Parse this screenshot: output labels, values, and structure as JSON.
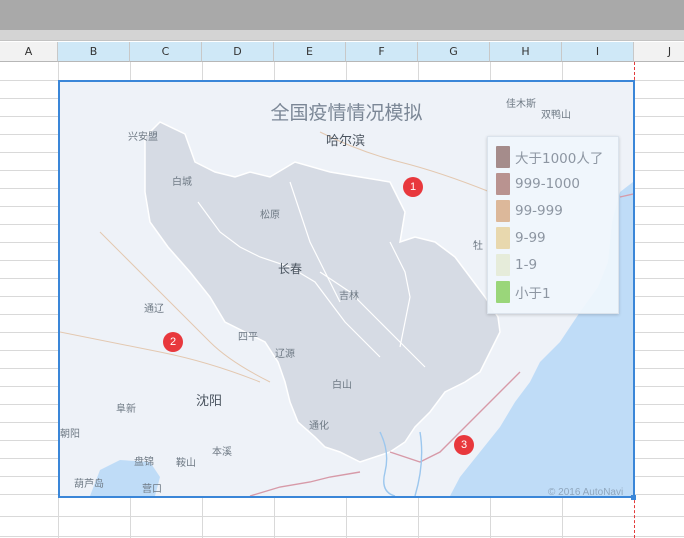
{
  "columns": [
    {
      "label": "A",
      "selected": false
    },
    {
      "label": "B",
      "selected": true
    },
    {
      "label": "C",
      "selected": true
    },
    {
      "label": "D",
      "selected": true
    },
    {
      "label": "E",
      "selected": true
    },
    {
      "label": "F",
      "selected": true
    },
    {
      "label": "G",
      "selected": true
    },
    {
      "label": "H",
      "selected": true
    },
    {
      "label": "I",
      "selected": true
    },
    {
      "label": "J",
      "selected": false
    }
  ],
  "chart": {
    "title": "全国疫情情况模拟",
    "copyright": "© 2016 AutoNavi",
    "legend": [
      {
        "label": "大于1000人了",
        "color": "#a58c8b"
      },
      {
        "label": "999-1000",
        "color": "#b99390"
      },
      {
        "label": "99-999",
        "color": "#dcb89a"
      },
      {
        "label": "9-99",
        "color": "#e8d8ae"
      },
      {
        "label": "1-9",
        "color": "#e6ecda"
      },
      {
        "label": "小于1",
        "color": "#9ad67a"
      }
    ],
    "markers": [
      "1",
      "2",
      "3"
    ],
    "places": {
      "harbin": "哈尔滨",
      "changchun": "长春",
      "shenyang": "沈阳",
      "xinganmeng": "兴安盟",
      "baicheng": "白城",
      "songyuan": "松原",
      "jilin": "吉林",
      "tonghua": "通化",
      "baishan": "白山",
      "siping": "四平",
      "liaoyuan": "辽源",
      "tongliao": "通辽",
      "fuxin": "阜新",
      "chaoyang": "朝阳",
      "huludao": "葫芦岛",
      "panjin": "盘锦",
      "anshan": "鞍山",
      "benxi": "本溪",
      "yingkou": "营口",
      "jiamusi": "佳木斯",
      "shuangyashan": "双鸭山",
      "mudanjiang": "牡"
    }
  }
}
